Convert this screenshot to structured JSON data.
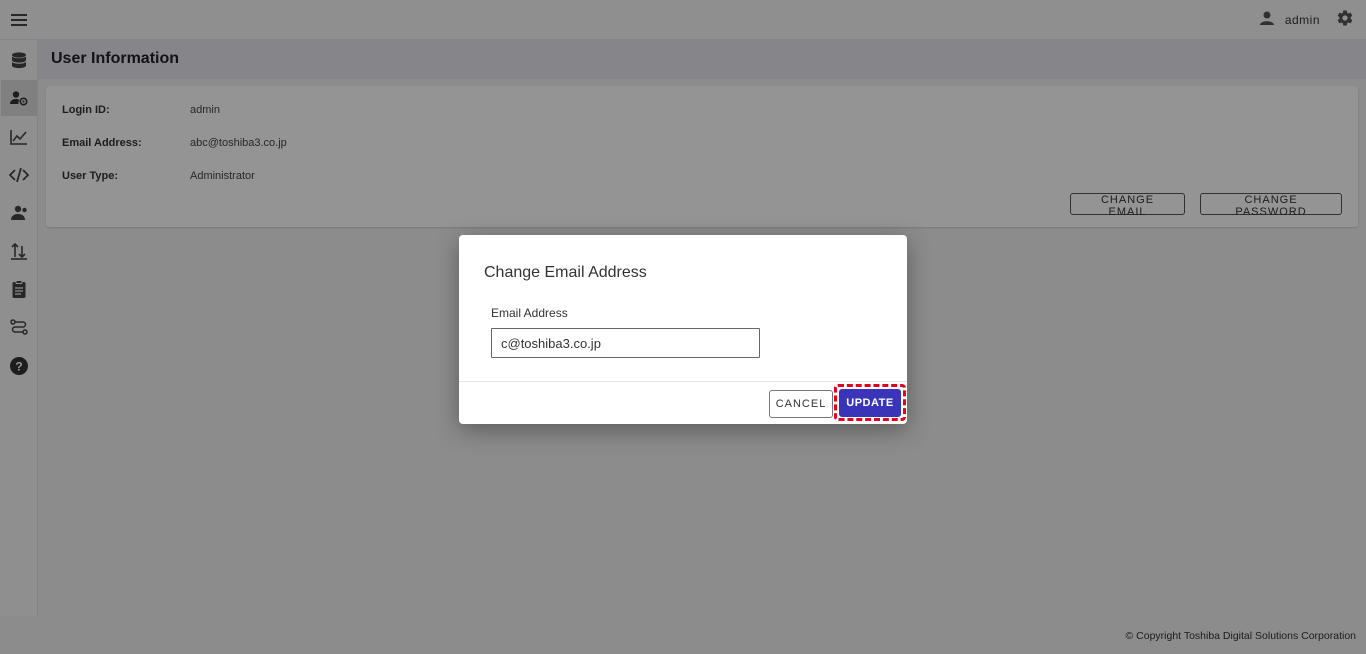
{
  "topbar": {
    "user_name": "admin"
  },
  "sidebar": {
    "items": [
      {
        "icon": "database-icon"
      },
      {
        "icon": "user-settings-icon",
        "active": true
      },
      {
        "icon": "chart-line-icon"
      },
      {
        "icon": "code-icon"
      },
      {
        "icon": "people-icon"
      },
      {
        "icon": "data-transfer-icon"
      },
      {
        "icon": "clipboard-icon"
      },
      {
        "icon": "route-icon"
      },
      {
        "icon": "help-icon"
      }
    ]
  },
  "page": {
    "title": "User Information",
    "fields": [
      {
        "label": "Login ID:",
        "value": "admin"
      },
      {
        "label": "Email Address:",
        "value": "abc@toshiba3.co.jp"
      },
      {
        "label": "User Type:",
        "value": "Administrator"
      }
    ],
    "change_email_label": "CHANGE EMAIL",
    "change_password_label": "CHANGE PASSWORD"
  },
  "dialog": {
    "title": "Change Email Address",
    "field_label": "Email Address",
    "email_value": "c@toshiba3.co.jp",
    "cancel_label": "CANCEL",
    "update_label": "UPDATE"
  },
  "footer": {
    "copyright": "© Copyright Toshiba Digital Solutions Corporation"
  },
  "colors": {
    "primary": "#3a35b8",
    "highlight": "#e0001b",
    "overlay": "rgba(0,0,0,0.42)"
  }
}
